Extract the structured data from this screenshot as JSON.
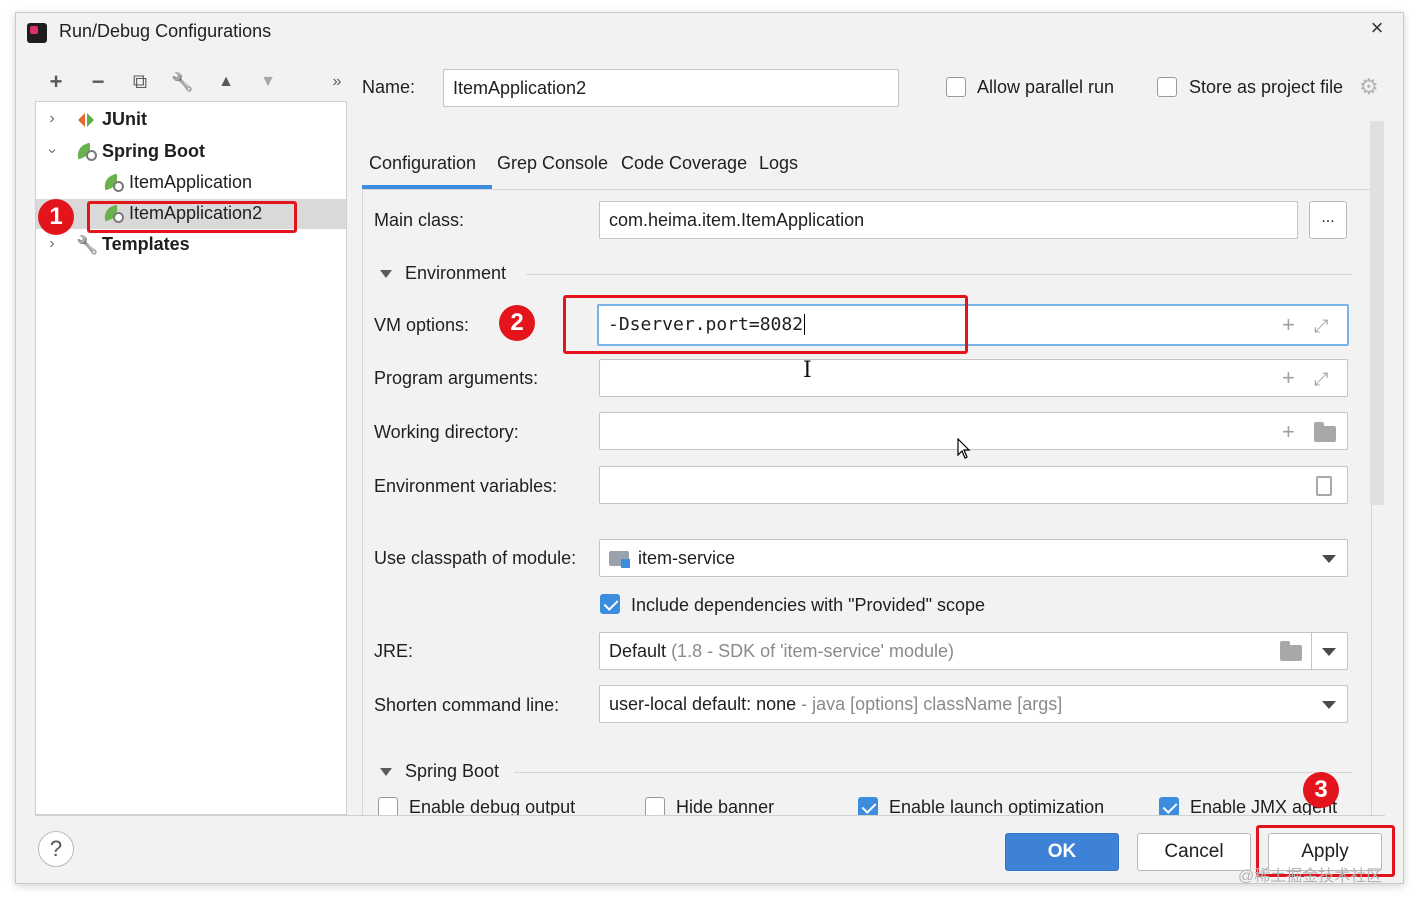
{
  "window": {
    "title": "Run/Debug Configurations",
    "close_icon": "×"
  },
  "toolbar": {
    "add": "+",
    "remove": "−",
    "copy": "⧉",
    "edit": "🔧",
    "up": "▲",
    "down": "▼",
    "more": "»"
  },
  "tree": {
    "junit": "JUnit",
    "spring_boot": "Spring Boot",
    "item_app": "ItemApplication",
    "item_app2": "ItemApplication2",
    "templates": "Templates"
  },
  "header": {
    "name_label": "Name:",
    "name_value": "ItemApplication2",
    "allow_parallel": "Allow parallel run",
    "store_as_file": "Store as project file"
  },
  "tabs": [
    "Configuration",
    "Grep Console",
    "Code Coverage",
    "Logs"
  ],
  "config": {
    "main_class_label": "Main class:",
    "main_class_value": "com.heima.item.ItemApplication",
    "browse_label": "...",
    "environment_label": "Environment",
    "vm_label": "VM options:",
    "vm_value": "-Dserver.port=8082",
    "program_args_label": "Program arguments:",
    "working_dir_label": "Working directory:",
    "env_vars_label": "Environment variables:",
    "classpath_label": "Use classpath of module:",
    "classpath_value": "item-service",
    "include_deps": "Include dependencies with \"Provided\" scope",
    "jre_label": "JRE:",
    "jre_value": "Default",
    "jre_detail": "(1.8 - SDK of 'item-service' module)",
    "shorten_label": "Shorten command line:",
    "shorten_value": "user-local default: none",
    "shorten_detail": "- java [options] className [args]",
    "spring_boot_section": "Spring Boot",
    "enable_debug": "Enable debug output",
    "hide_banner": "Hide banner",
    "enable_launch_opt": "Enable launch optimization",
    "enable_jmx": "Enable JMX agent"
  },
  "badges": {
    "one": "1",
    "two": "2",
    "three": "3"
  },
  "buttons": {
    "help": "?",
    "ok": "OK",
    "cancel": "Cancel",
    "apply": "Apply"
  },
  "watermark": "@稀土掘金技术社区",
  "colors": {
    "accent": "#3d8ddf",
    "highlight": "#e3141c",
    "primary_button": "#3d82d6"
  }
}
